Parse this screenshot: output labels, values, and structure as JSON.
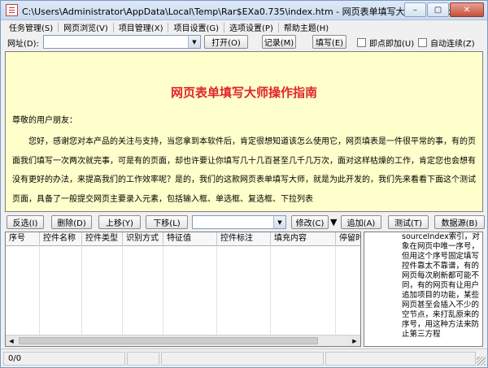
{
  "window": {
    "title": "C:\\Users\\Administrator\\AppData\\Local\\Temp\\Rar$EXa0.735\\index.htm - 网页表单填写大师(FillMaster) - ...",
    "minimize_label": "–",
    "restore_label": "▢",
    "close_label": "✕"
  },
  "menu": [
    "任务管理(S)",
    "网页浏览(V)",
    "项目管理(X)",
    "项目设置(G)",
    "选项设置(P)",
    "帮助主题(H)"
  ],
  "address": {
    "label": "网址(D):",
    "value": "",
    "open_label": "打开(O)",
    "record_label": "记录(M)",
    "fill_label": "填写(E)",
    "instant_fill_label": "即点即加(U)",
    "auto_continue_label": "自动连续(Z)"
  },
  "document": {
    "title": "网页表单填写大师操作指南",
    "greeting": "尊敬的用户朋友：",
    "paragraph": "您好，感谢您对本产品的关注与支持，当您拿到本软件后，肯定很想知道该怎么使用它，网页填表是一件很平常的事，有的页面我们填写一次两次就完事，可是有的页面，却也许要让你填写几十几百甚至几千几万次，面对这样枯燥的工作，肯定您也会想有没有更好的办法，来提高我们的工作效率呢？是的，我们的这款网页表单填写大师，就是为此开发的，我们先来看看下面这个测试页面，具备了一般提交网页主要录入元素，包括输入框、单选框、复选框、下拉列表"
  },
  "toolbar": {
    "reverse_label": "反选(I)",
    "delete_label": "删除(D)",
    "up_label": "上移(Y)",
    "down_label": "下移(L)",
    "select_value": "",
    "modify_label": "修改(C)",
    "add_label": "追加(A)",
    "test_label": "测试(T)",
    "datasource_label": "数据源(B)"
  },
  "table": {
    "columns": [
      "序号",
      "控件名称",
      "控件类型",
      "识别方式",
      "特征值",
      "控件标注",
      "填充内容",
      "停留时"
    ]
  },
  "help": {
    "text": "sourceIndex索引，对象在网页中唯一序号，但用这个序号固定填写控件靠太不靠谱，有的网页每次刷新都可能不同，有的网页有让用户追加项目的功能，某些网页甚至会插入不少的空节点，来打乱原来的序号，用这种方法来防止第三方程"
  },
  "status": {
    "count": "0/0"
  }
}
